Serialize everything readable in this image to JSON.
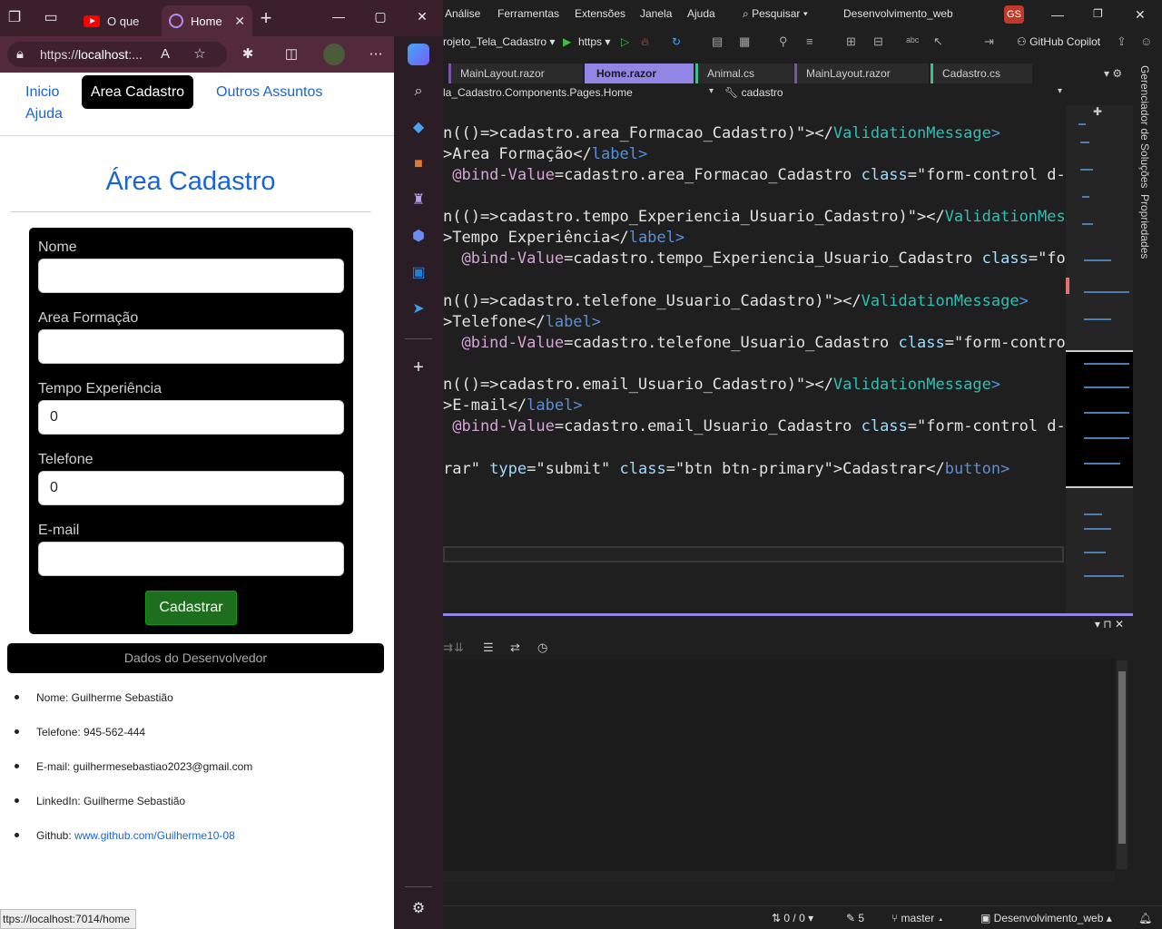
{
  "browser": {
    "tabs": [
      {
        "title": "O que",
        "active": false
      },
      {
        "title": "Home",
        "active": true
      }
    ],
    "url": {
      "scheme": "https://",
      "host": "localhost",
      "rest": ":..."
    },
    "status_url": "ttps://localhost:7014/home",
    "glyphs": {
      "close": "✕",
      "new_tab": "+",
      "minimize": "—",
      "maximize": "▢",
      "more": "⋯"
    }
  },
  "site": {
    "nav": {
      "inicio": "Inicio",
      "area_cadastro": "Area Cadastro",
      "outros": "Outros Assuntos",
      "ajuda": "Ajuda"
    },
    "title": "Área Cadastro",
    "form": {
      "nome_label": "Nome",
      "nome_value": "",
      "area_label": "Area Formação",
      "area_value": "",
      "tempo_label": "Tempo Experiência",
      "tempo_value": "0",
      "telefone_label": "Telefone",
      "telefone_value": "0",
      "email_label": "E-mail",
      "email_value": "",
      "submit": "Cadastrar"
    },
    "dev_header": "Dados do Desenvolvedor",
    "dev": {
      "nome": "Nome: Guilherme Sebastião",
      "telefone": "Telefone: 945-562-444",
      "email": "E-mail: guilhermesebastiao2023@gmail.com",
      "linkedin": "LinkedIn: Guilherme Sebastião",
      "github_prefix": "Github: ",
      "github_link": "www.github.com/Guilherme10-08"
    }
  },
  "vs": {
    "menus": {
      "analise": "Análise",
      "ferramentas": "Ferramentas",
      "extensoes": "Extensões",
      "janela": "Janela",
      "ajuda": "Ajuda"
    },
    "search": "Pesquisar",
    "solution": "Desenvolvimento_web",
    "user_initials": "GS",
    "toolbar": {
      "project": "rojeto_Tela_Cadastro",
      "launch": "https",
      "copilot": "GitHub Copilot"
    },
    "doc_tabs": [
      "MainLayout.razor",
      "Home.razor",
      "Animal.cs",
      "MainLayout.razor",
      "Cadastro.cs"
    ],
    "nav_combo_1": "la_Cadastro.Components.Pages.Home",
    "nav_combo_2": "cadastro",
    "code": {
      "l1a": "n(()=>cadastro.area_Formacao_Cadastro)\"></",
      "l1b": "ValidationMessage",
      "l1c": ">",
      "l2a": ">Area Formação</",
      "l2b": "label",
      "l2c": ">",
      "l3a": " @bind-Value",
      "l3b": "=cadastro.area_Formacao_Cadastro ",
      "l3c": "class",
      "l3d": "=\"form-control d-",
      "l4a": "n(()=>cadastro.tempo_Experiencia_Usuario_Cadastro)\"></",
      "l4b": "ValidationMes",
      "l5a": ">Tempo Experiência</",
      "l5b": "label",
      "l5c": ">",
      "l6a": "  @bind-Value",
      "l6b": "=cadastro.tempo_Experiencia_Usuario_Cadastro ",
      "l6c": "class",
      "l6d": "=\"fo",
      "l7a": "n(()=>cadastro.telefone_Usuario_Cadastro)\"></",
      "l7b": "ValidationMessage",
      "l7c": ">",
      "l8a": ">Telefone</",
      "l8b": "label",
      "l8c": ">",
      "l9a": "  @bind-Value",
      "l9b": "=cadastro.telefone_Usuario_Cadastro ",
      "l9c": "class",
      "l9d": "=\"form-contro",
      "l10a": "n(()=>cadastro.email_Usuario_Cadastro)\"></",
      "l10b": "ValidationMessage",
      "l10c": ">",
      "l11a": ">E-mail</",
      "l11b": "label",
      "l11c": ">",
      "l12a": " @bind-Value",
      "l12b": "=cadastro.email_Usuario_Cadastro ",
      "l12c": "class",
      "l12d": "=\"form-control d-",
      "l13a": "rar\" ",
      "l13b": "type",
      "l13c": "=\"submit\" ",
      "l13d": "class",
      "l13e": "=\"btn btn-primary\">Cadastrar</",
      "l13f": "button",
      "l13g": ">"
    },
    "rail": {
      "solution_explorer": "Gerenciador de Soluções",
      "properties": "Propriedades"
    },
    "status": {
      "lines": "0 / 0",
      "edits": "5",
      "branch": "master",
      "repo": "Desenvolvimento_web"
    }
  },
  "colors": {
    "edge_frame": "#3b1f2a",
    "vs_accent": "#9186e6",
    "link": "#1a64d6",
    "submit": "#1d6e1d"
  },
  "icons": [
    "workspaces-icon",
    "tab-actions-icon",
    "lock-icon",
    "read-aloud-icon",
    "favorite-icon",
    "extensions-icon",
    "split-screen-icon",
    "profile-icon",
    "copilot-icon",
    "search-icon",
    "tag-icon",
    "briefcase-icon",
    "chess-icon",
    "edge-icon",
    "outlook-icon",
    "send-icon",
    "add-icon",
    "settings-icon"
  ]
}
